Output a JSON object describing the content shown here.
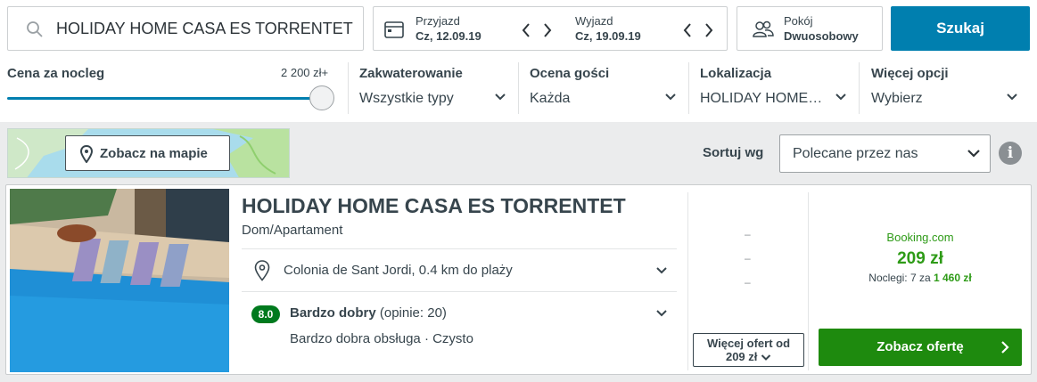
{
  "search": {
    "destination": "HOLIDAY HOME CASA ES TORRENTET"
  },
  "dates": {
    "checkin_label": "Przyjazd",
    "checkin_value": "Cz, 12.09.19",
    "checkout_label": "Wyjazd",
    "checkout_value": "Cz, 19.09.19"
  },
  "room": {
    "label": "Pokój",
    "value": "Dwuosobowy"
  },
  "search_button": "Szukaj",
  "filters": {
    "price_title": "Cena za nocleg",
    "price_max": "2 200 zł+",
    "price_level": 1.0,
    "accommodation_title": "Zakwaterowanie",
    "accommodation_value": "Wszystkie typy",
    "rating_title": "Ocena gości",
    "rating_value": "Każda",
    "location_title": "Lokalizacja",
    "location_value": "HOLIDAY HOME…",
    "more_title": "Więcej opcji",
    "more_value": "Wybierz"
  },
  "map_button": "Zobacz na mapie",
  "sort": {
    "label": "Sortuj wg",
    "value": "Polecane przez nas"
  },
  "info_icon": "i",
  "result": {
    "name": "HOLIDAY HOME CASA ES TORRENTET",
    "type": "Dom/Apartament",
    "location": "Colonia de Sant Jordi, 0.4 km do plaży",
    "rating_score": "8.0",
    "rating_label": "Bardzo dobry",
    "rating_count": "(opinie: 20)",
    "highlights": "Bardzo dobra obsługa · Czysto",
    "placeholders": [
      "–",
      "–",
      "–"
    ],
    "more_offers_line1": "Więcej ofert od",
    "more_offers_line2": "209 zł",
    "partner": "Booking.com",
    "price": "209 zł",
    "nights_text": "Noclegi: 7 za",
    "nights_total": "1 460 zł",
    "deal_button": "Zobacz ofertę"
  },
  "colors": {
    "primary": "#007faf",
    "deal_green": "#1e8a0e",
    "price_green": "#2e9b17",
    "rating_green": "#007a1e"
  }
}
